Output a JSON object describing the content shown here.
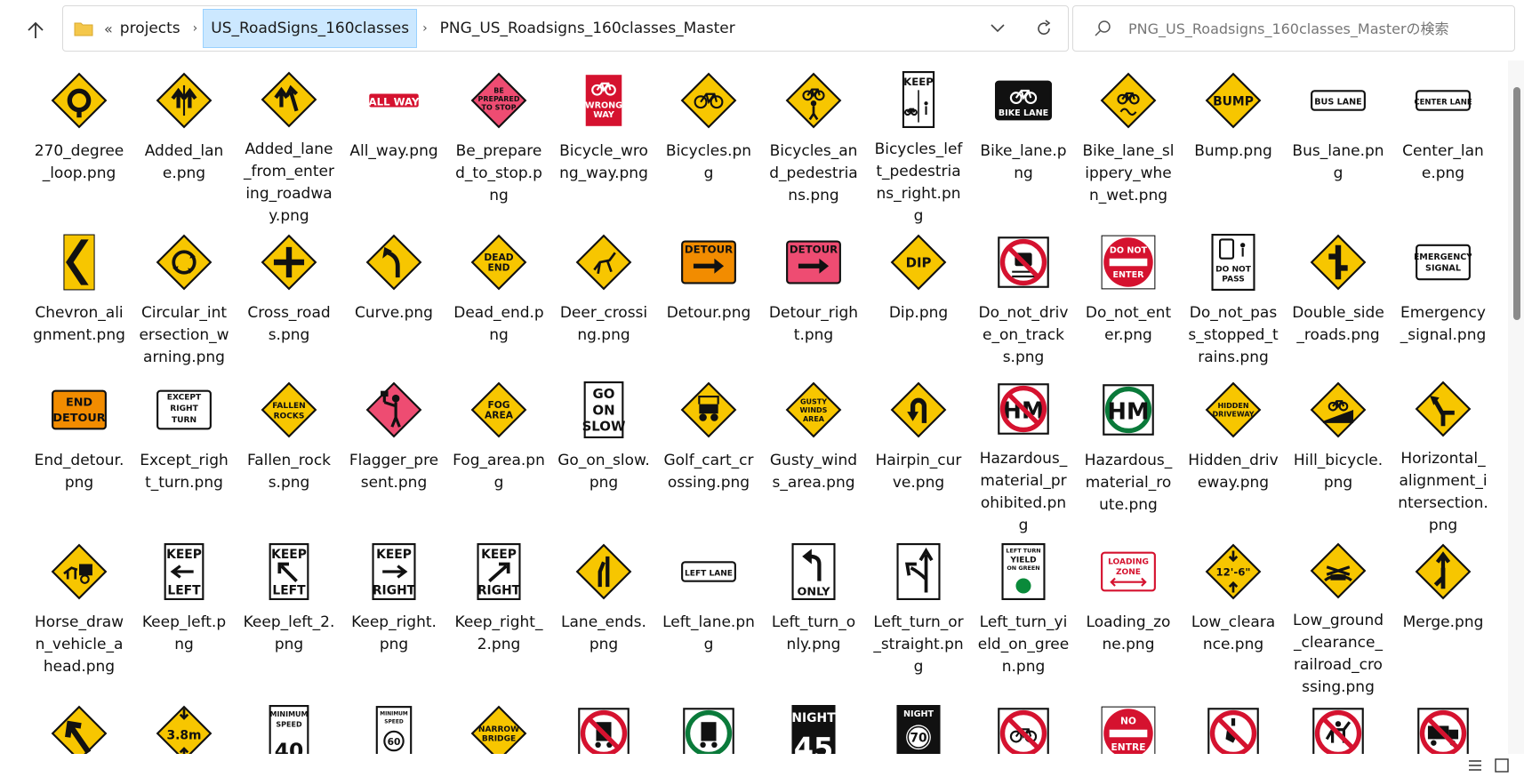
{
  "address": {
    "breadcrumbs": [
      "projects",
      "US_RoadSigns_160classes",
      "PNG_US_Roadsigns_160classes_Master"
    ],
    "overflow": "«"
  },
  "search": {
    "placeholder": "PNG_US_Roadsigns_160classes_Masterの検索"
  },
  "files": [
    {
      "name": "270_degree_loop.png",
      "icon": "loop-sign-icon"
    },
    {
      "name": "Added_lane.png",
      "icon": "added-lane-sign-icon"
    },
    {
      "name": "Added_lane_from_entering_roadway.png",
      "icon": "added-lane-entering-sign-icon"
    },
    {
      "name": "All_way.png",
      "icon": "all-way-plaque-icon"
    },
    {
      "name": "Be_prepared_to_stop.png",
      "icon": "be-prepared-sign-icon"
    },
    {
      "name": "Bicycle_wrong_way.png",
      "icon": "bicycle-wrong-way-sign-icon"
    },
    {
      "name": "Bicycles.png",
      "icon": "bicycles-sign-icon"
    },
    {
      "name": "Bicycles_and_pedestrians.png",
      "icon": "bicycles-pedestrians-sign-icon"
    },
    {
      "name": "Bicycles_left_pedestrians_right.png",
      "icon": "keep-left-right-sign-icon"
    },
    {
      "name": "Bike_lane.png",
      "icon": "bike-lane-sign-icon"
    },
    {
      "name": "Bike_lane_slippery_when_wet.png",
      "icon": "slippery-bike-sign-icon"
    },
    {
      "name": "Bump.png",
      "icon": "bump-sign-icon"
    },
    {
      "name": "Bus_lane.png",
      "icon": "bus-lane-sign-icon"
    },
    {
      "name": "Center_lane.png",
      "icon": "center-lane-sign-icon"
    },
    {
      "name": "Chevron_alignment.png",
      "icon": "chevron-sign-icon"
    },
    {
      "name": "Circular_intersection_warning.png",
      "icon": "circular-intersection-sign-icon"
    },
    {
      "name": "Cross_roads.png",
      "icon": "cross-roads-sign-icon"
    },
    {
      "name": "Curve.png",
      "icon": "curve-sign-icon"
    },
    {
      "name": "Dead_end.png",
      "icon": "dead-end-sign-icon"
    },
    {
      "name": "Deer_crossing.png",
      "icon": "deer-crossing-sign-icon"
    },
    {
      "name": "Detour.png",
      "icon": "detour-sign-icon"
    },
    {
      "name": "Detour_right.png",
      "icon": "detour-right-sign-icon"
    },
    {
      "name": "Dip.png",
      "icon": "dip-sign-icon"
    },
    {
      "name": "Do_not_drive_on_tracks.png",
      "icon": "no-drive-tracks-sign-icon"
    },
    {
      "name": "Do_not_enter.png",
      "icon": "do-not-enter-sign-icon"
    },
    {
      "name": "Do_not_pass_stopped_trains.png",
      "icon": "do-not-pass-trains-sign-icon"
    },
    {
      "name": "Double_side_roads.png",
      "icon": "double-side-roads-sign-icon"
    },
    {
      "name": "Emergency_signal.png",
      "icon": "emergency-signal-sign-icon"
    },
    {
      "name": "End_detour.png",
      "icon": "end-detour-sign-icon"
    },
    {
      "name": "Except_right_turn.png",
      "icon": "except-right-turn-sign-icon"
    },
    {
      "name": "Fallen_rocks.png",
      "icon": "fallen-rocks-sign-icon"
    },
    {
      "name": "Flagger_present.png",
      "icon": "flagger-sign-icon"
    },
    {
      "name": "Fog_area.png",
      "icon": "fog-area-sign-icon"
    },
    {
      "name": "Go_on_slow.png",
      "icon": "go-on-slow-sign-icon"
    },
    {
      "name": "Golf_cart_crossing.png",
      "icon": "golf-cart-sign-icon"
    },
    {
      "name": "Gusty_winds_area.png",
      "icon": "gusty-winds-sign-icon"
    },
    {
      "name": "Hairpin_curve.png",
      "icon": "hairpin-curve-sign-icon"
    },
    {
      "name": "Hazardous_material_prohibited.png",
      "icon": "hm-prohibited-sign-icon"
    },
    {
      "name": "Hazardous_material_route.png",
      "icon": "hm-route-sign-icon"
    },
    {
      "name": "Hidden_driveway.png",
      "icon": "hidden-driveway-sign-icon"
    },
    {
      "name": "Hill_bicycle.png",
      "icon": "hill-bicycle-sign-icon"
    },
    {
      "name": "Horizontal_alignment_intersection.png",
      "icon": "horizontal-alignment-sign-icon"
    },
    {
      "name": "Horse_drawn_vehicle_ahead.png",
      "icon": "horse-drawn-sign-icon"
    },
    {
      "name": "Keep_left.png",
      "icon": "keep-left-sign-icon"
    },
    {
      "name": "Keep_left_2.png",
      "icon": "keep-left-2-sign-icon"
    },
    {
      "name": "Keep_right.png",
      "icon": "keep-right-sign-icon"
    },
    {
      "name": "Keep_right_2.png",
      "icon": "keep-right-2-sign-icon"
    },
    {
      "name": "Lane_ends.png",
      "icon": "lane-ends-sign-icon"
    },
    {
      "name": "Left_lane.png",
      "icon": "left-lane-sign-icon"
    },
    {
      "name": "Left_turn_only.png",
      "icon": "left-turn-only-sign-icon"
    },
    {
      "name": "Left_turn_or_straight.png",
      "icon": "left-turn-straight-sign-icon"
    },
    {
      "name": "Left_turn_yield_on_green.png",
      "icon": "left-turn-yield-sign-icon"
    },
    {
      "name": "Loading_zone.png",
      "icon": "loading-zone-sign-icon"
    },
    {
      "name": "Low_clearance.png",
      "icon": "low-clearance-sign-icon"
    },
    {
      "name": "Low_ground_clearance_railroad_crossing.png",
      "icon": "low-ground-railroad-sign-icon"
    },
    {
      "name": "Merge.png",
      "icon": "merge-sign-icon"
    },
    {
      "name": "",
      "icon": "merge-left-sign-icon"
    },
    {
      "name": "",
      "icon": "clearance-3-8m-sign-icon"
    },
    {
      "name": "",
      "icon": "minimum-speed-40-sign-icon"
    },
    {
      "name": "",
      "icon": "minimum-speed-60-sign-icon"
    },
    {
      "name": "",
      "icon": "narrow-bridge-sign-icon"
    },
    {
      "name": "",
      "icon": "no-trucks-sign-icon"
    },
    {
      "name": "",
      "icon": "trucks-allowed-sign-icon"
    },
    {
      "name": "",
      "icon": "night-45-sign-icon"
    },
    {
      "name": "",
      "icon": "night-70-sign-icon"
    },
    {
      "name": "",
      "icon": "no-bicycles-sign-icon"
    },
    {
      "name": "",
      "icon": "no-entre-sign-icon"
    },
    {
      "name": "",
      "icon": "no-hitchhiking-sign-icon"
    },
    {
      "name": "",
      "icon": "no-horses-sign-icon"
    },
    {
      "name": "",
      "icon": "no-trucks-2-sign-icon"
    }
  ],
  "sign_text": {
    "all_way": "ALL WAY",
    "be_prepared": [
      "BE",
      "PREPARED",
      "TO STOP"
    ],
    "wrong_way": [
      "WRONG",
      "WAY"
    ],
    "keep": "KEEP",
    "bike_lane": "BIKE LANE",
    "bump": "BUMP",
    "bus_lane": "BUS LANE",
    "center_lane": "CENTER LANE",
    "dead_end": [
      "DEAD",
      "END"
    ],
    "detour": "DETOUR",
    "dip": "DIP",
    "do_not_enter": [
      "DO NOT",
      "ENTER"
    ],
    "do_not_pass": [
      "DO NOT",
      "PASS"
    ],
    "emergency_signal": [
      "EMERGENCY",
      "SIGNAL"
    ],
    "end_detour": [
      "END",
      "DETOUR"
    ],
    "except_right_turn": [
      "EXCEPT",
      "RIGHT",
      "TURN"
    ],
    "fallen_rocks": [
      "FALLEN",
      "ROCKS"
    ],
    "fog_area": [
      "FOG",
      "AREA"
    ],
    "go_on_slow": [
      "GO",
      "ON",
      "SLOW"
    ],
    "gusty_winds": [
      "GUSTY",
      "WINDS",
      "AREA"
    ],
    "hm": "HM",
    "hidden_driveway": [
      "HIDDEN",
      "DRIVEWAY"
    ],
    "left": "LEFT",
    "right": "RIGHT",
    "left_lane": "LEFT LANE",
    "only": "ONLY",
    "left_turn_yield": [
      "LEFT TURN",
      "YIELD",
      "ON GREEN"
    ],
    "loading_zone": [
      "LOADING",
      "ZONE"
    ],
    "low_clearance": "12'-6\"",
    "clearance_m": "3.8m",
    "minimum_speed": [
      "MINIMUM",
      "SPEED"
    ],
    "speed_40": "40",
    "speed_60": "60",
    "narrow_bridge": [
      "NARROW",
      "BRIDGE"
    ],
    "night": "NIGHT",
    "speed_45": "45",
    "speed_70": "70",
    "no": "NO",
    "entre": "ENTRE"
  }
}
